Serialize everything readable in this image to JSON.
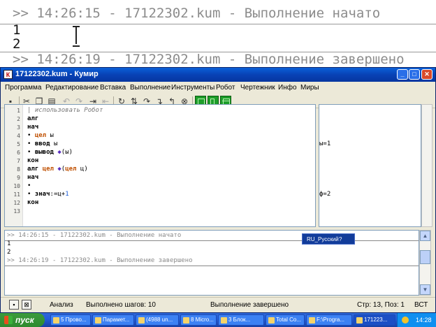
{
  "zoom": {
    "lines": [
      {
        "text": ">> 14:26:15 - 17122302.kum - Выполнение начато",
        "tone": "gray"
      },
      {
        "text": "1",
        "tone": "black"
      },
      {
        "text": "2",
        "tone": "black"
      },
      {
        "text": ">> 14:26:19 - 17122302.kum - Выполнение завершено",
        "tone": "gray"
      }
    ]
  },
  "window": {
    "title": "17122302.kum - Кумир",
    "app_icon_letter": "К"
  },
  "menu": [
    "Программа",
    "Редактирование",
    "Вставка",
    "Выполнение",
    "Инструменты",
    "Робот",
    "Чертежник",
    "Инфо",
    "Миры"
  ],
  "editor": {
    "line_numbers": [
      "1",
      "2",
      "3",
      "4",
      "5",
      "6",
      "7",
      "8",
      "9",
      "10",
      "11",
      "12",
      "13"
    ],
    "code": {
      "l1": {
        "comment": "| использовать Робот"
      },
      "l2": {
        "kw": "алг"
      },
      "l3": {
        "kw": "нач"
      },
      "l4": {
        "bullet": "•",
        "type": "цел",
        "rest": " ы"
      },
      "l5": {
        "bullet": "•",
        "kw": "ввод",
        "rest": " ы"
      },
      "l6": {
        "bullet": "•",
        "kw": "вывод",
        "diamond": "◆",
        "rest": "(ы)"
      },
      "l7": {
        "kw": "кон"
      },
      "l8": {
        "kw": "алг",
        "type": "цел",
        "diamond": "◆",
        "open": "(",
        "type2": "цел",
        "rest": " ц)"
      },
      "l9": {
        "kw": "нач"
      },
      "l10": {
        "bullet": "•"
      },
      "l11": {
        "bullet": "•",
        "kw": "знач",
        "rest": ":=ц+",
        "num": "1"
      },
      "l12": {
        "kw": "кон"
      },
      "l13": {}
    }
  },
  "margin": {
    "values": [
      {
        "line": 5,
        "text": "ы=1"
      },
      {
        "line": 11,
        "text": "ф=2"
      }
    ]
  },
  "output": {
    "lines": [
      {
        "text": ">> 14:26:15 - 17122302.kum - Выполнение начато",
        "tone": "gray"
      },
      {
        "text": "1",
        "tone": "black"
      },
      {
        "text": "2",
        "tone": "black"
      },
      {
        "text": ">> 14:26:19 - 17122302.kum - Выполнение завершено",
        "tone": "gray"
      }
    ]
  },
  "status": {
    "mode": "Анализ",
    "steps": "Выполнено шагов: 10",
    "state": "Выполнение завершено",
    "position": "Стр: 13, Поз: 1",
    "insert": "ВСТ"
  },
  "langbar": {
    "lang": "RU_Русский",
    "help": "?"
  },
  "taskbar": {
    "start_label": "пуск",
    "buttons": [
      "5 Прово...",
      "Парамет...",
      "(4988 un...",
      "8 Micro...",
      "3 Блок...",
      "Total Co...",
      "F:\\Progra...",
      "171223..."
    ],
    "clock": "14:28"
  },
  "colors": {
    "title_bar": "#0842b5",
    "keyword_type": "#c05000",
    "number": "#1a5bd8",
    "start_button": "#2f8a2f"
  }
}
